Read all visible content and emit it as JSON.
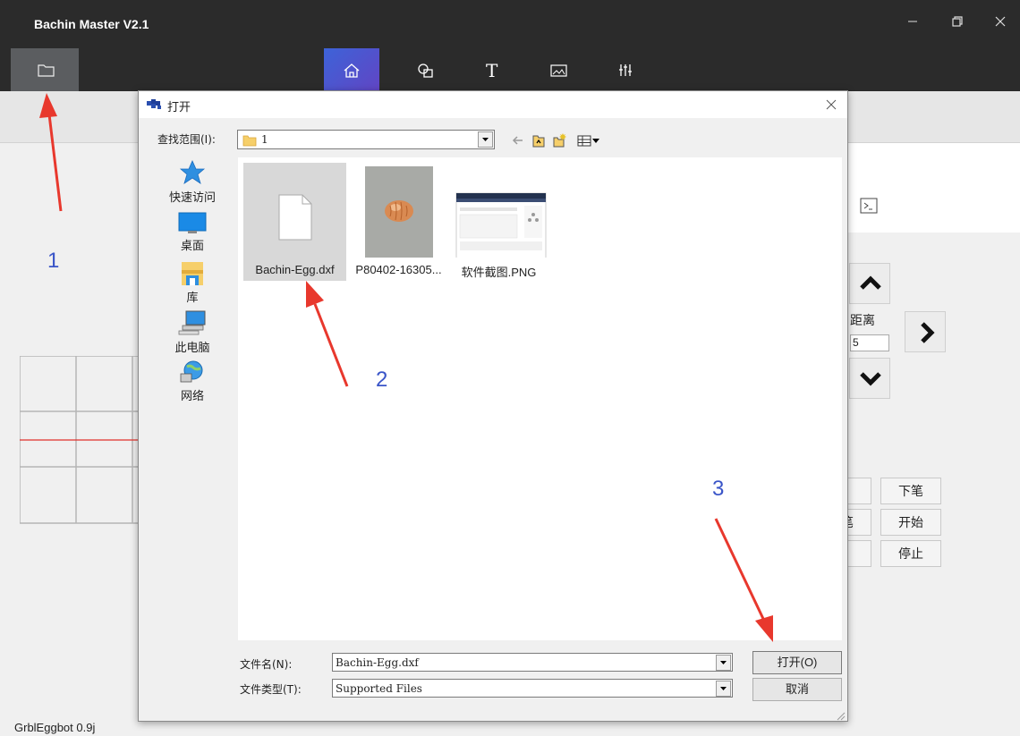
{
  "app": {
    "title": "Bachin Master V2.1",
    "status_firmware": "GrblEggbot 0.9j"
  },
  "toolbar": {
    "items": [
      "folder-icon",
      "home-icon",
      "shapes-icon",
      "text-icon",
      "image-icon",
      "sliders-icon"
    ],
    "text_tool_glyph": "T"
  },
  "controls": {
    "distance_label": "距离",
    "distance_value": "5",
    "pen_down": "下笔",
    "start": "开始",
    "stop": "停止",
    "partial_button_text": "笔"
  },
  "dialog": {
    "title": "打开",
    "look_in_label": "查找范围(I):",
    "look_in_value": "1",
    "places": [
      {
        "label": "快速访问",
        "icon": "star-icon"
      },
      {
        "label": "桌面",
        "icon": "desktop-icon"
      },
      {
        "label": "库",
        "icon": "library-icon"
      },
      {
        "label": "此电脑",
        "icon": "computer-icon"
      },
      {
        "label": "网络",
        "icon": "network-icon"
      }
    ],
    "files": [
      {
        "name": "Bachin-Egg.dxf",
        "selected": true
      },
      {
        "name": "P80402-16305...",
        "selected": false
      },
      {
        "name": "软件截图.PNG",
        "selected": false
      }
    ],
    "file_name_label": "文件名(N):",
    "file_name_value": "Bachin-Egg.dxf",
    "file_type_label": "文件类型(T):",
    "file_type_value": "Supported Files",
    "open_button": "打开(O)",
    "cancel_button": "取消"
  },
  "annotations": {
    "step1": "1",
    "step2": "2",
    "step3": "3",
    "arrow_color": "#e8382d",
    "number_color": "#3a55c8"
  },
  "colors": {
    "titlebar_bg": "#2b2b2b",
    "active_tool_gradient_start": "#3d63d8",
    "active_tool_gradient_end": "#6145c4",
    "grid_line": "#b5b5b5",
    "red_line": "#e0312b"
  }
}
